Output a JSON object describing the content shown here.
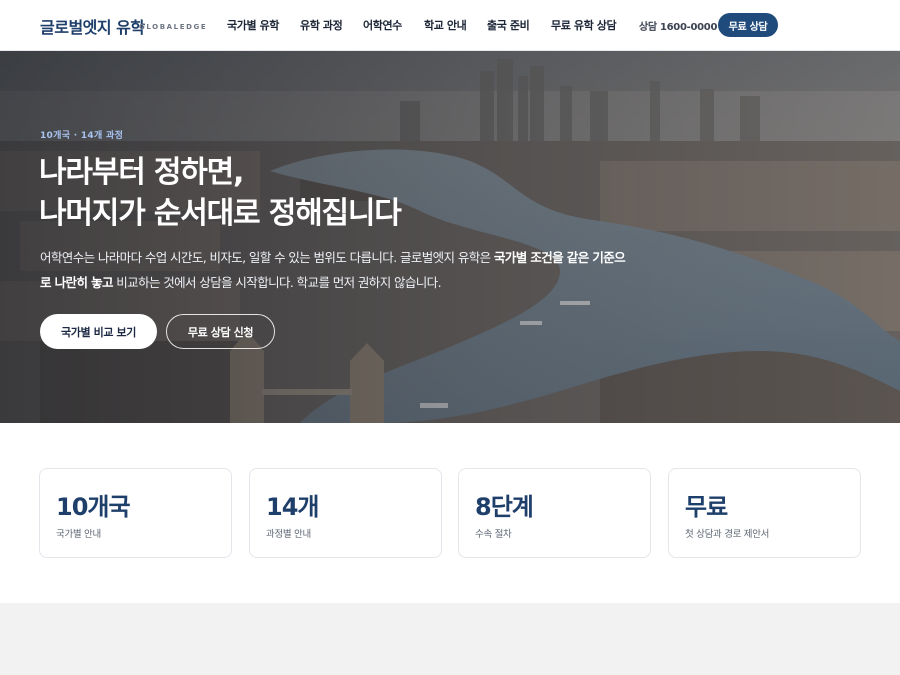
{
  "header": {
    "logo": "글로벌엣지 유학",
    "logo_sub": "GLOBALEDGE",
    "nav": [
      "국가별 유학",
      "유학 과정",
      "어학연수",
      "학교 안내",
      "출국 준비",
      "무료 유학 상담"
    ],
    "phone": "상담 1600-0000",
    "cta": "무료 상담"
  },
  "hero": {
    "eyebrow": "10개국 · 14개 과정",
    "title_line1": "나라부터 정하면,",
    "title_line2": "나머지가 순서대로 정해집니다",
    "desc_part1": "어학연수는 나라마다 수업 시간도, 비자도, 일할 수 있는 범위도 다릅니다. 글로벌엣지 유학은 ",
    "desc_bold": "국가별 조건을 같은 기준으로 나란히 놓고",
    "desc_part2": " 비교하는 것에서 상담을 시작합니다. 학교를 먼저 권하지 않습니다.",
    "btn_primary": "국가별 비교 보기",
    "btn_secondary": "무료 상담 신청"
  },
  "stats": [
    {
      "value": "10개국",
      "label": "국가별 안내"
    },
    {
      "value": "14개",
      "label": "과정별 안내"
    },
    {
      "value": "8단계",
      "label": "수속 절차"
    },
    {
      "value": "무료",
      "label": "첫 상담과 경로 제안서"
    }
  ],
  "colors": {
    "brand": "#1f4a7c",
    "brand_text": "#1f3f6b",
    "eyebrow": "#a8c3f0"
  }
}
